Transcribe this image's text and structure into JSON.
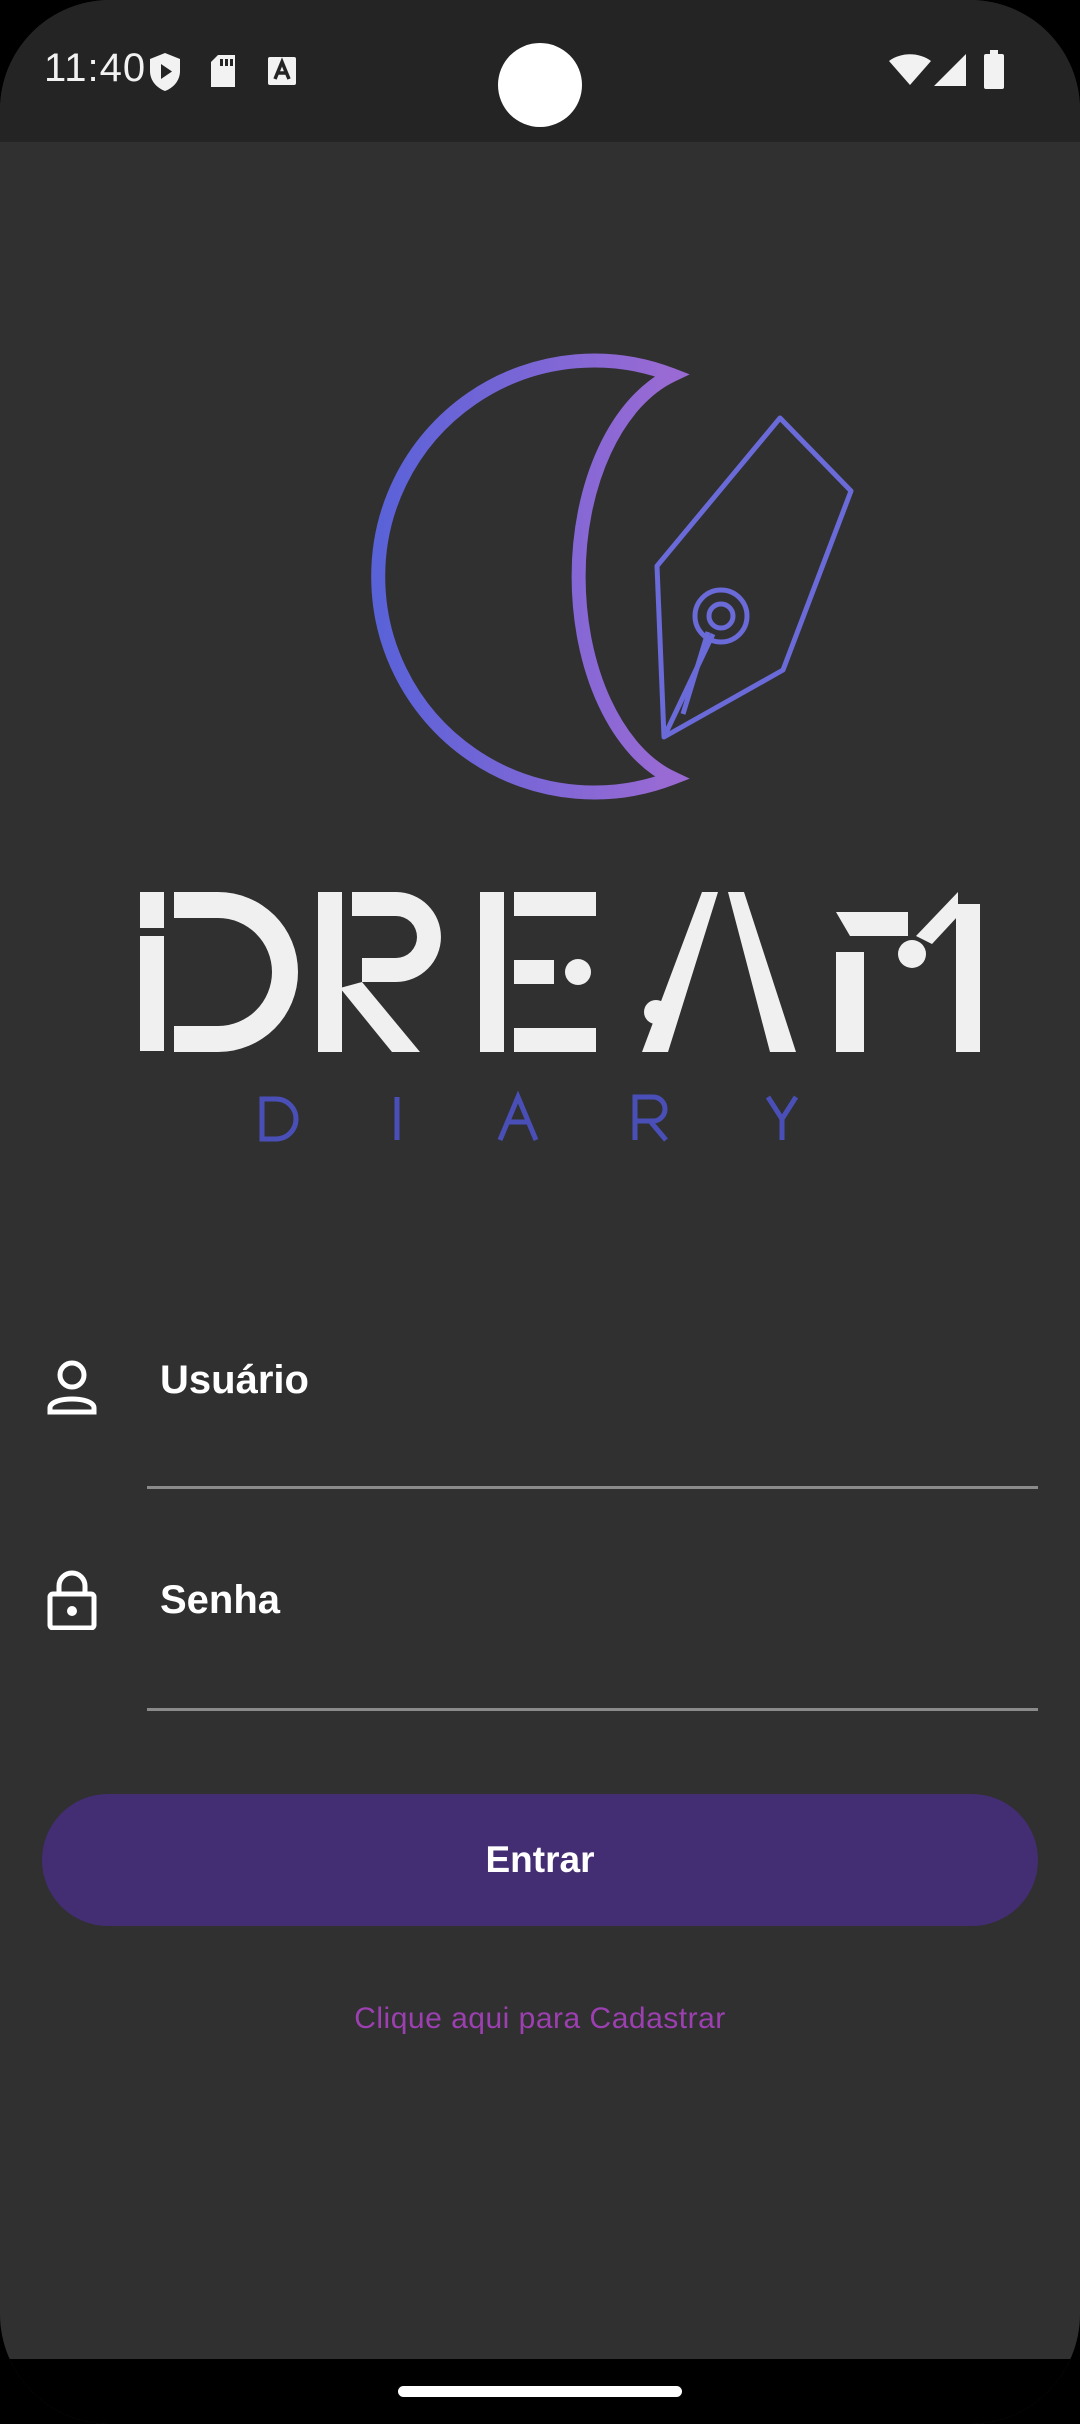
{
  "status_bar": {
    "time": "11:40",
    "left_icons": [
      "shield-play-icon",
      "sd-card-icon",
      "font-a-icon"
    ],
    "right_icons": [
      "wifi-icon",
      "cellular-signal-icon",
      "battery-icon"
    ]
  },
  "logo": {
    "title": "DREAM",
    "subtitle": "DIARY",
    "icon": "moon-pen-nib-icon",
    "colors": {
      "moon_start": "#5a62d8",
      "moon_end": "#9a6ad4",
      "title": "#f2f2f2",
      "subtitle": "#4a4fb8",
      "pen": "#6a6ad8"
    }
  },
  "form": {
    "username": {
      "label": "Usuário",
      "icon": "person-icon"
    },
    "password": {
      "label": "Senha",
      "icon": "lock-icon"
    },
    "submit_label": "Entrar",
    "register_link": "Clique aqui para Cadastrar"
  },
  "colors": {
    "background": "#303030",
    "status_bar": "#242424",
    "button": "#432d73",
    "link": "#9c3fb0",
    "underline": "#8a8a8a"
  }
}
